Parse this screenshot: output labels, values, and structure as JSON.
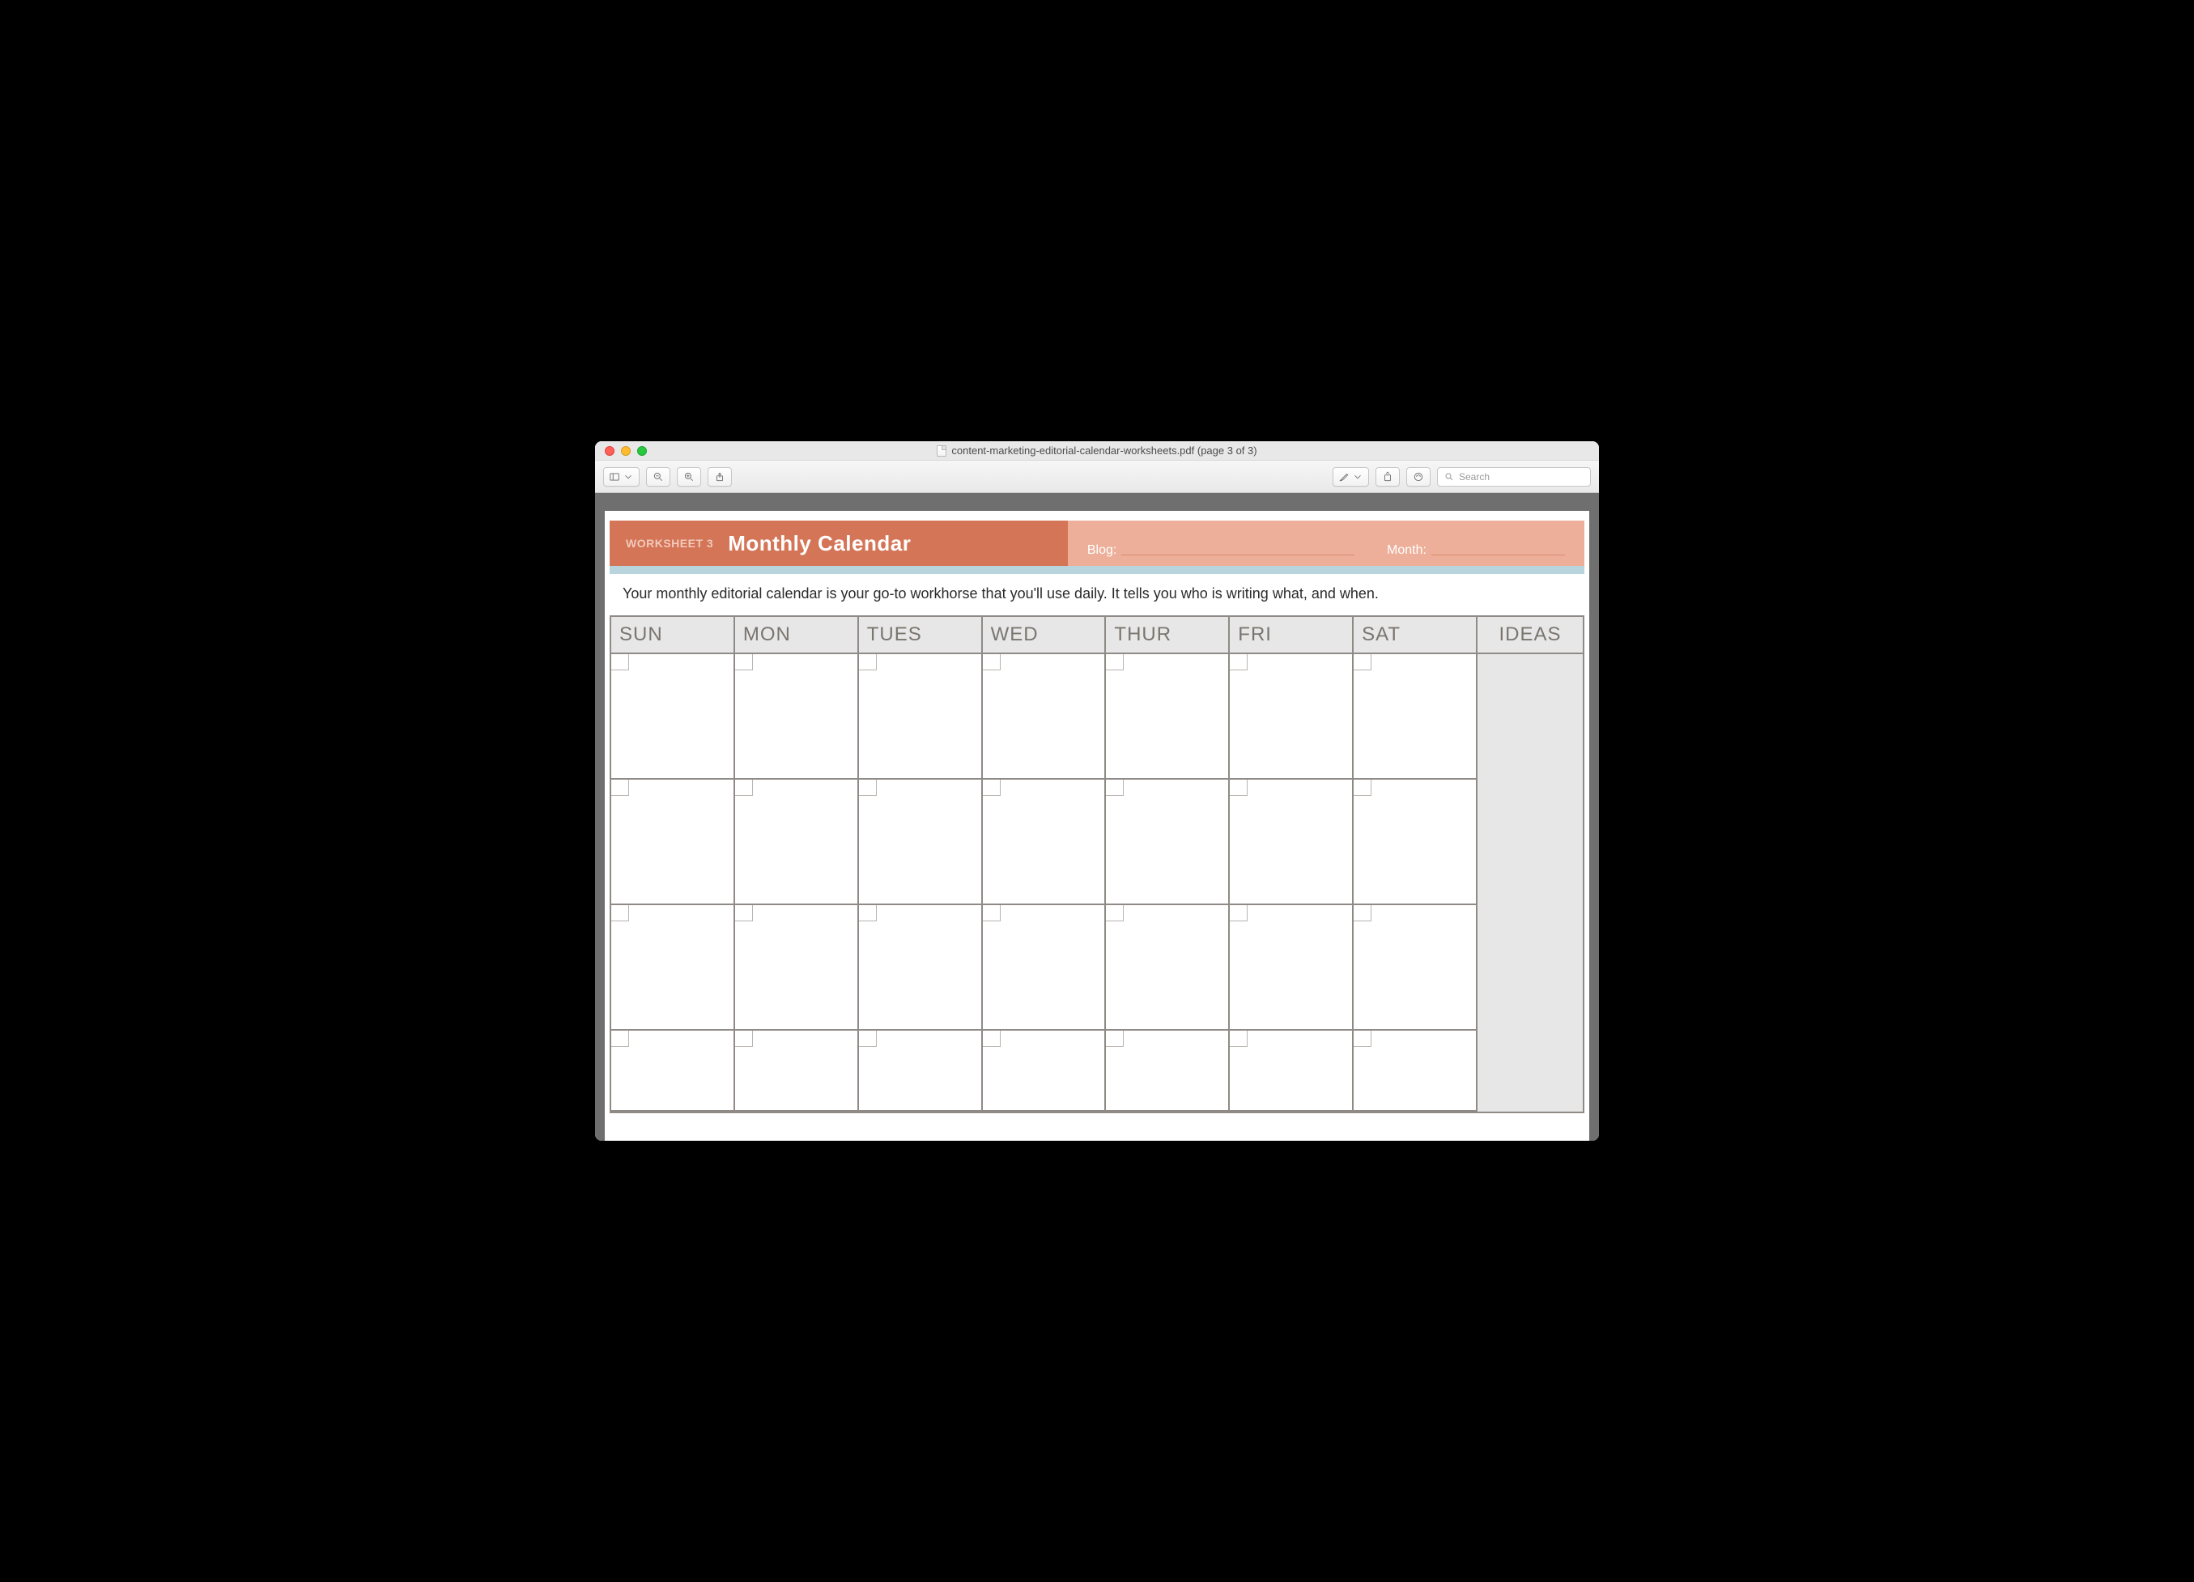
{
  "window": {
    "title": "content-marketing-editorial-calendar-worksheets.pdf (page 3 of 3)"
  },
  "toolbar": {
    "search_placeholder": "Search"
  },
  "worksheet": {
    "number_label": "WORKSHEET 3",
    "title": "Monthly Calendar",
    "blog_label": "Blog:",
    "month_label": "Month:",
    "description": "Your monthly editorial calendar is your go-to workhorse that you'll use daily. It tells you who is writing what, and when."
  },
  "calendar": {
    "days": [
      "SUN",
      "MON",
      "TUES",
      "WED",
      "THUR",
      "FRI",
      "SAT"
    ],
    "ideas_label": "IDEAS",
    "visible_rows": 4
  }
}
